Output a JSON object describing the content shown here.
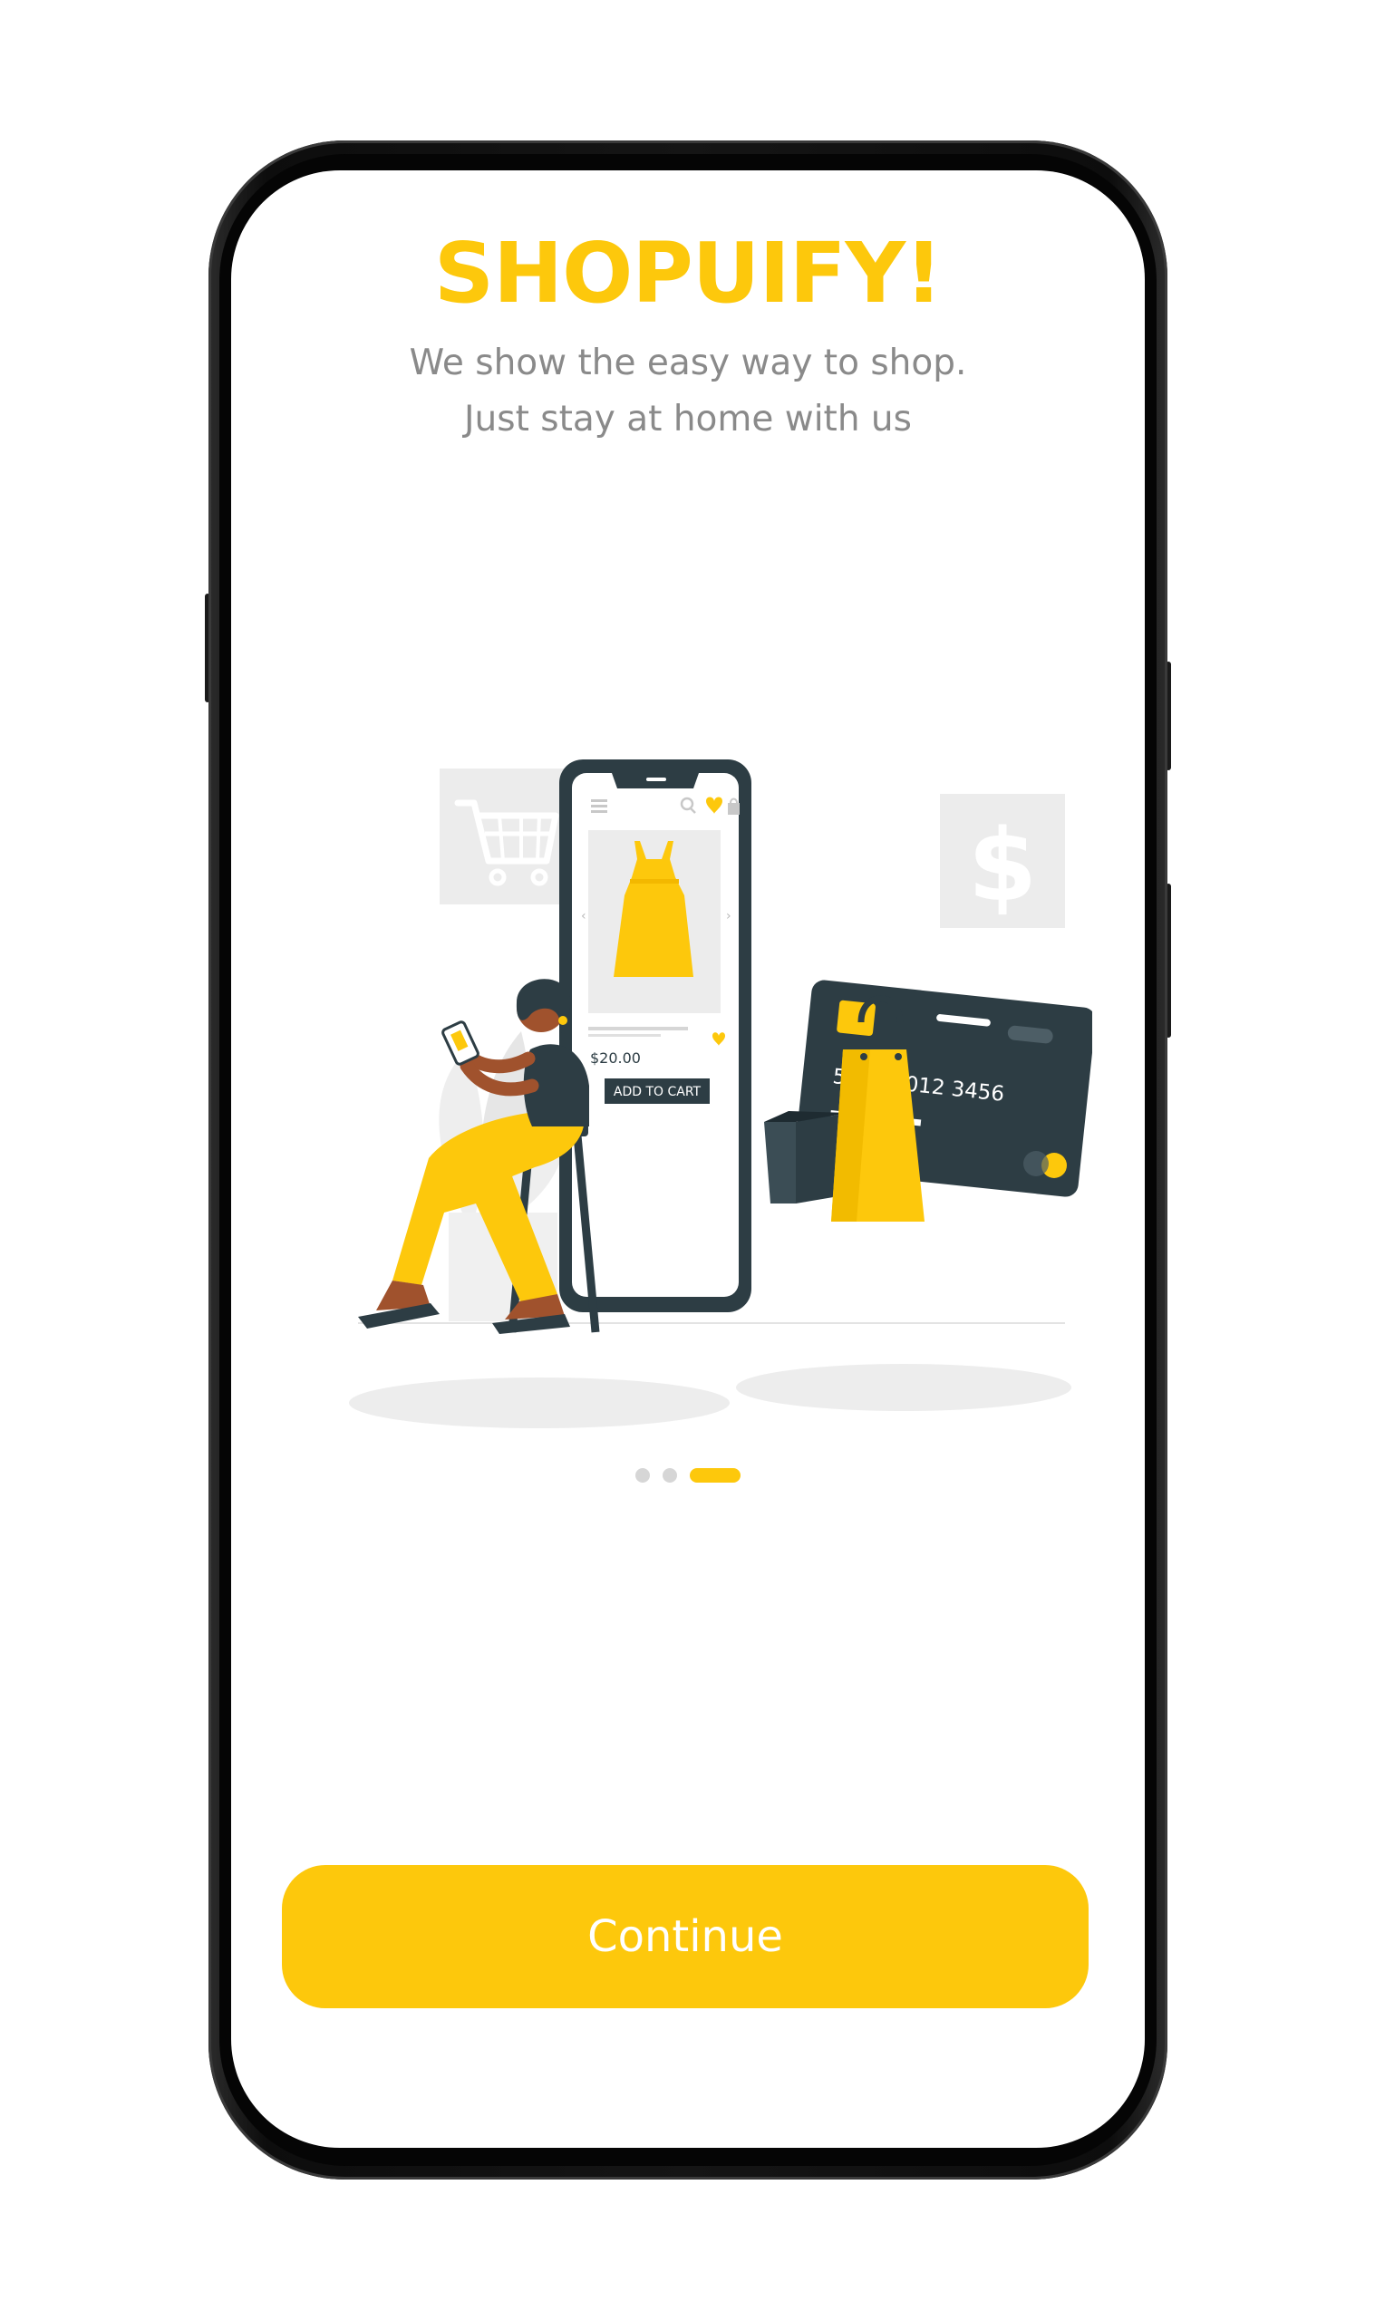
{
  "app": {
    "title": "SHOPUIFY!",
    "tagline_line1": "We show the easy way to shop.",
    "tagline_line2": "Just stay at home with us"
  },
  "illustration": {
    "price": "$20.00",
    "add_to_cart": "ADD TO CART",
    "card_number": "5678 9012 3456",
    "icons": [
      "shopping-cart-icon",
      "dollar-icon",
      "heart-icon",
      "search-icon",
      "bag-icon",
      "menu-icon"
    ]
  },
  "pager": {
    "total": 3,
    "active_index": 2
  },
  "actions": {
    "continue_label": "Continue"
  },
  "colors": {
    "accent": "#fdc80c",
    "dark": "#2d3d44",
    "muted_text": "#8a8a8a",
    "light_gray": "#ebebeb"
  }
}
